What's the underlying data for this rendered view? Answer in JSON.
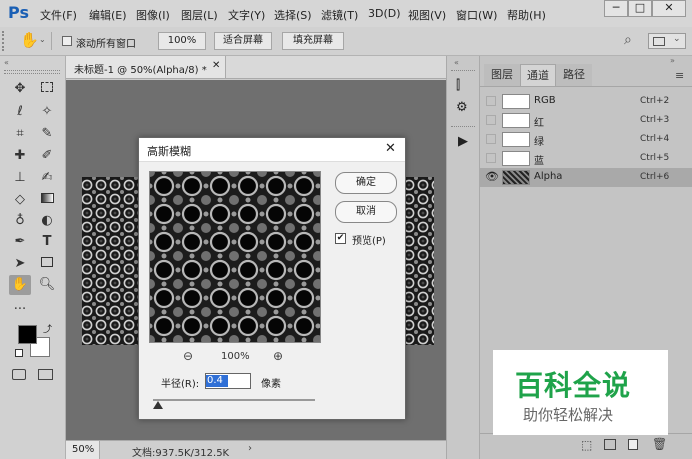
{
  "app": {
    "logo": "Ps",
    "menu": [
      "文件(F)",
      "编辑(E)",
      "图像(I)",
      "图层(L)",
      "文字(Y)",
      "选择(S)",
      "滤镜(T)",
      "3D(D)",
      "视图(V)",
      "窗口(W)",
      "帮助(H)"
    ],
    "window_buttons": [
      "─",
      "□",
      "✕"
    ]
  },
  "options_bar": {
    "scroll_all_label": "滚动所有窗口",
    "zoom_100": "100%",
    "fit_screen": "适合屏幕",
    "fill_screen": "填充屏幕"
  },
  "document": {
    "tab_title": "未标题-1 @ 50%(Alpha/8) *",
    "zoom": "50%",
    "doc_info": "文档:937.5K/312.5K"
  },
  "panel": {
    "tabs": [
      "图层",
      "通道",
      "路径"
    ],
    "active_tab": 1,
    "channels": [
      {
        "name": "RGB",
        "shortcut": "Ctrl+2"
      },
      {
        "name": "红",
        "shortcut": "Ctrl+3"
      },
      {
        "name": "绿",
        "shortcut": "Ctrl+4"
      },
      {
        "name": "蓝",
        "shortcut": "Ctrl+5"
      },
      {
        "name": "Alpha",
        "shortcut": "Ctrl+6"
      }
    ]
  },
  "dialog": {
    "title": "高斯模糊",
    "ok": "确定",
    "cancel": "取消",
    "preview_label": "预览(P)",
    "preview_checked": true,
    "preview_zoom": "100%",
    "radius_label": "半径(R):",
    "radius_value": "0.4",
    "radius_unit": "像素"
  },
  "watermark": {
    "title": "百科全说",
    "subtitle": "助你轻松解决"
  },
  "colors": {
    "accent": "#1a5fb4",
    "watermark_green": "#1fa34a",
    "foreground": "#000000",
    "background": "#ffffff"
  }
}
